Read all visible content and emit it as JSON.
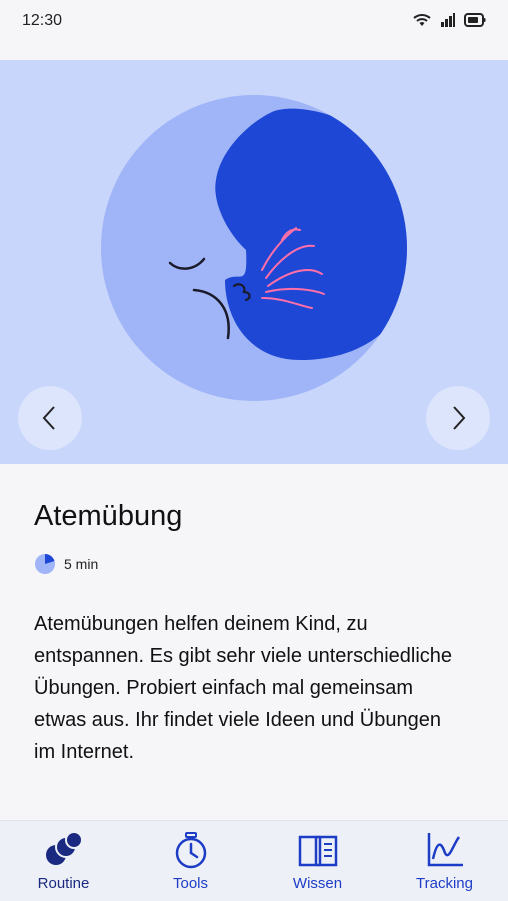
{
  "status_bar": {
    "time": "12:30",
    "icons": [
      "wifi-icon",
      "signal-icon",
      "battery-icon"
    ]
  },
  "hero": {
    "background_color": "#c9d6fb",
    "prev_icon": "chevron-left-icon",
    "next_icon": "chevron-right-icon"
  },
  "exercise": {
    "title": "Atemübung",
    "duration": "5 min",
    "description": "Atemübungen helfen deinem Kind, zu entspannen. Es gibt sehr viele unterschiedliche Übungen. Probiert einfach mal gemeinsam etwas aus. Ihr findet viele Ideen und Übungen im Internet."
  },
  "tabbar": {
    "tabs": [
      {
        "label": "Routine",
        "icon": "routine-icon",
        "active": true
      },
      {
        "label": "Tools",
        "icon": "stopwatch-icon",
        "active": false
      },
      {
        "label": "Wissen",
        "icon": "book-icon",
        "active": false
      },
      {
        "label": "Tracking",
        "icon": "chart-icon",
        "active": false
      }
    ]
  },
  "colors": {
    "accent": "#1d3dc7",
    "active_tab": "#1a2a80",
    "moon_light": "#9fb5f7",
    "moon_dark": "#1f47d6",
    "breath_lines": "#ff6fa8"
  }
}
